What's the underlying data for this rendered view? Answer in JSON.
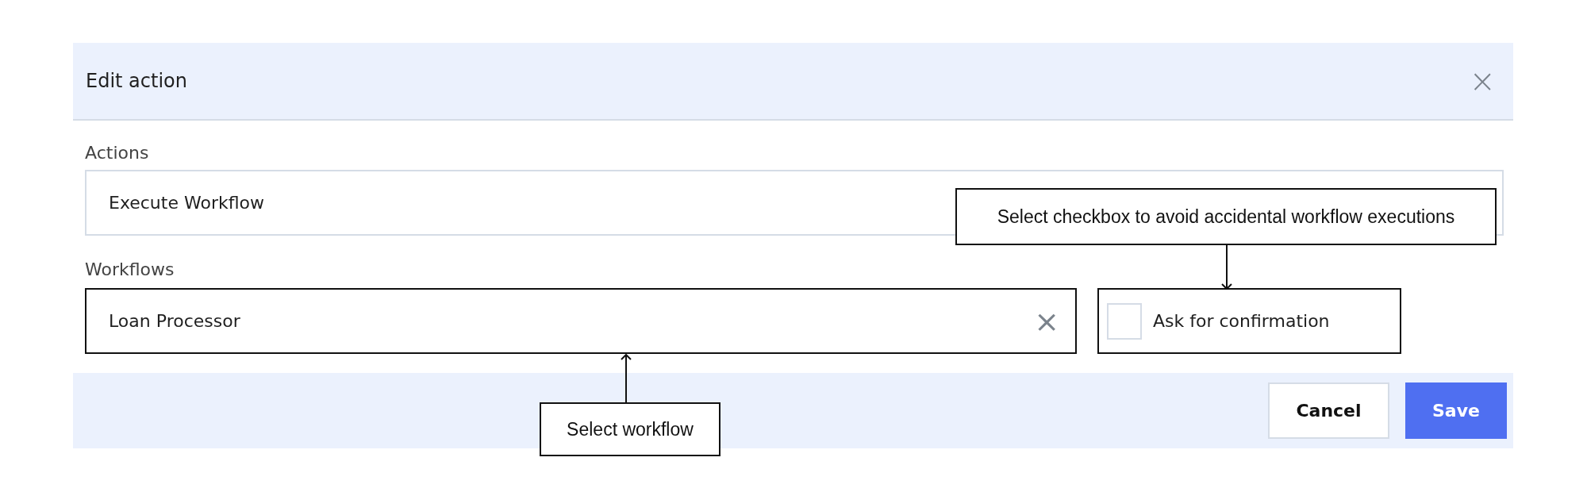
{
  "dialog": {
    "title": "Edit action",
    "close": "×"
  },
  "actions_field": {
    "label": "Actions",
    "value": "Execute Workflow"
  },
  "workflows_field": {
    "label": "Workflows",
    "value": "Loan Processor",
    "clear": "×"
  },
  "confirmation": {
    "label": "Ask for confirmation",
    "checked": false
  },
  "buttons": [
    {
      "label": "Cancel",
      "kind": "secondary"
    },
    {
      "label": "Save",
      "kind": "primary"
    }
  ],
  "annotations": [
    {
      "text": "Select checkbox to avoid accidental workflow executions"
    },
    {
      "text": "Select workflow"
    }
  ]
}
